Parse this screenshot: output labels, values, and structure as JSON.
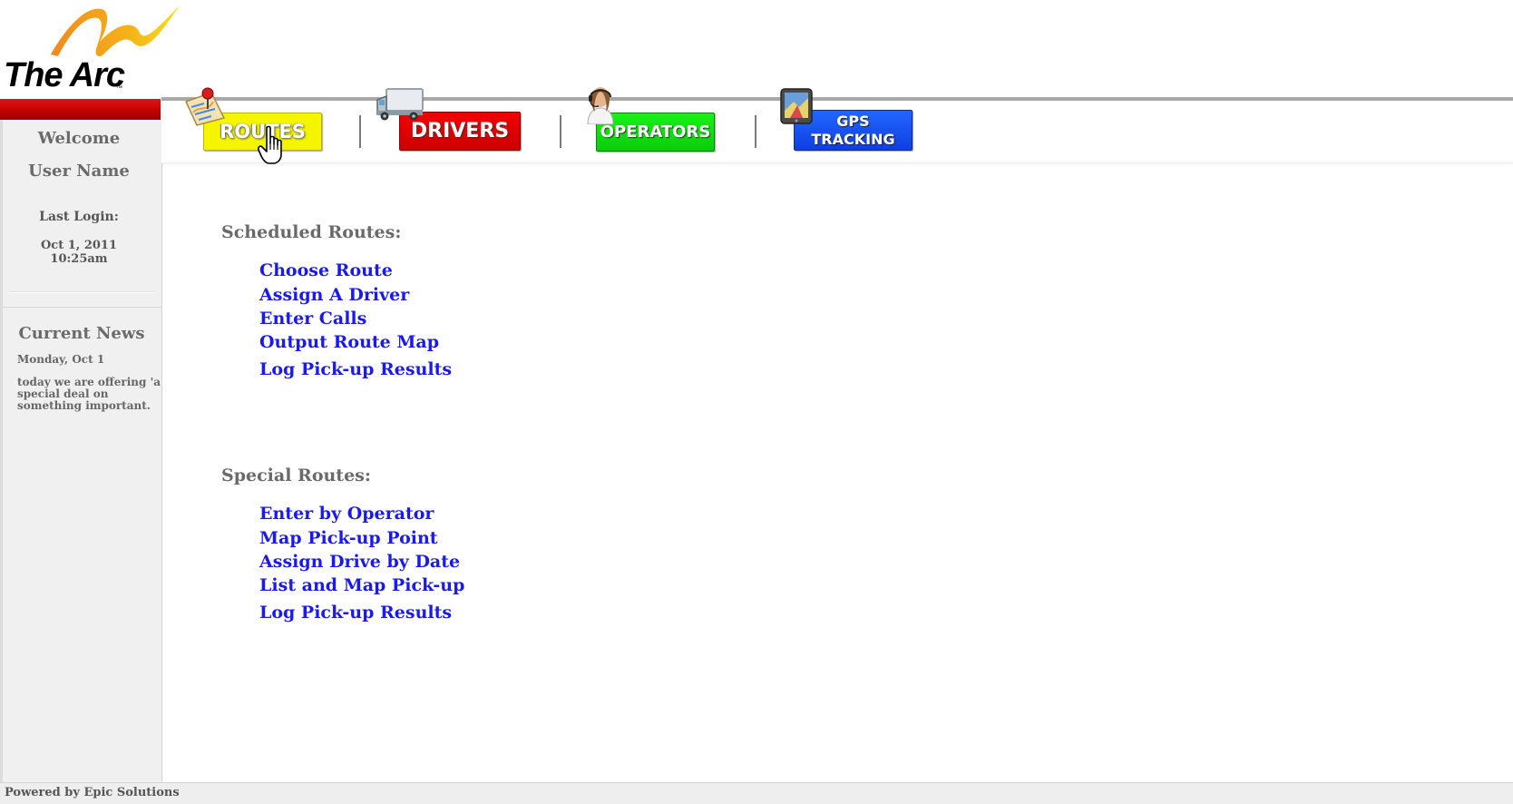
{
  "logo": {
    "text": "The Arc",
    "tm": "™"
  },
  "sidebar": {
    "welcome": "Welcome",
    "user_name": "User Name",
    "last_login_label": "Last Login:",
    "last_login_date": "Oct 1, 2011",
    "last_login_time": "10:25am",
    "news_title": "Current News",
    "news_date": "Monday, Oct 1",
    "news_body": "today we are offering 'a special deal on something important."
  },
  "nav": {
    "routes": "ROUTES",
    "drivers": "DRIVERS",
    "operators": "OPERATORS",
    "gps_line1": "GPS",
    "gps_line2": "TRACKING"
  },
  "scheduled": {
    "title": "Scheduled Routes:",
    "links": [
      "Choose Route",
      "Assign A Driver",
      "Enter Calls",
      "Output Route Map",
      "Log Pick-up Results"
    ]
  },
  "special": {
    "title": "Special Routes:",
    "links": [
      "Enter by Operator",
      "Map Pick-up Point",
      "Assign Drive by Date",
      "List and Map Pick-up",
      "Log Pick-up Results"
    ]
  },
  "footer": {
    "text": "Powered by Epic Solutions"
  },
  "colors": {
    "accent_red": "#cc0000",
    "link_blue": "#1a1aee",
    "routes_yellow": "#f5f500",
    "drivers_red": "#e60000",
    "operators_green": "#11e011",
    "gps_blue": "#1a55f5"
  },
  "icons": {
    "routes": "map-pin-icon",
    "drivers": "truck-icon",
    "operators": "headset-operator-icon",
    "gps": "gps-device-icon",
    "cursor": "hand-cursor-icon"
  }
}
